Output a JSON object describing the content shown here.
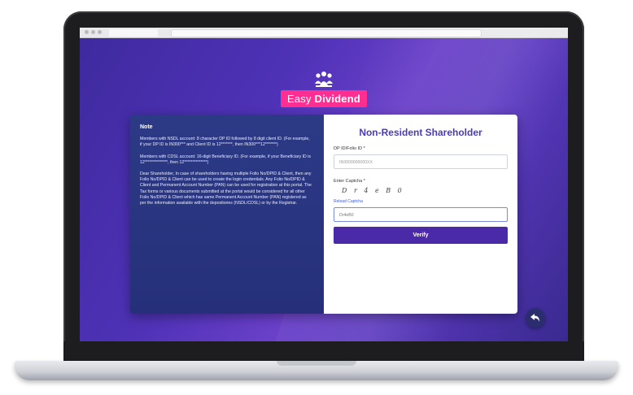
{
  "app": {
    "logo_text_prefix": "Easy ",
    "logo_text_bold": "Dividend"
  },
  "note": {
    "heading": "Note",
    "para1": "Members with NSDL account: 8 character DP ID followed by 8 digit client ID. (For example, if your DP ID is IN300*** and Client ID is 12*******, then IN300***12*******)",
    "para2": "Members with CDSL account: 16-digit Beneficiary ID. (For example, if your Beneficiary ID is 12**************, then 12**************)",
    "para3": "Dear Shareholder, In case of shareholders having multiple Folio No/DPID & Client, then any Folio No/DPID & Client can be used to create the login credentials. Any Folio No/DPID & Client and Permanent Account Number (PAN) can be used for registration at this portal. The Tax forms or various documents submitted at the portal would be considered for all other Folio No/DPID & Client which has same Permanent Account Number (PAN) registered as per the information available with the depositories (NSDL/CDSL) or by the Registrar."
  },
  "form": {
    "title": "Non-Resident Shareholder",
    "dpid_label": "DP ID/Folio ID *",
    "dpid_value": "IN3000000000XX",
    "captcha_label": "Enter Captcha *",
    "captcha_text": "D r 4 e B 0",
    "reload_label": "Reload Captcha",
    "captcha_value": "Dr4eB0",
    "verify_label": "Verify"
  },
  "colors": {
    "accent": "#4b2aa8",
    "logo_badge": "#ff2f92",
    "title": "#4a3bb8",
    "note_bg": "#2c3a86"
  },
  "icons": {
    "logo": "people-group-icon",
    "back": "back-arrow-icon"
  }
}
